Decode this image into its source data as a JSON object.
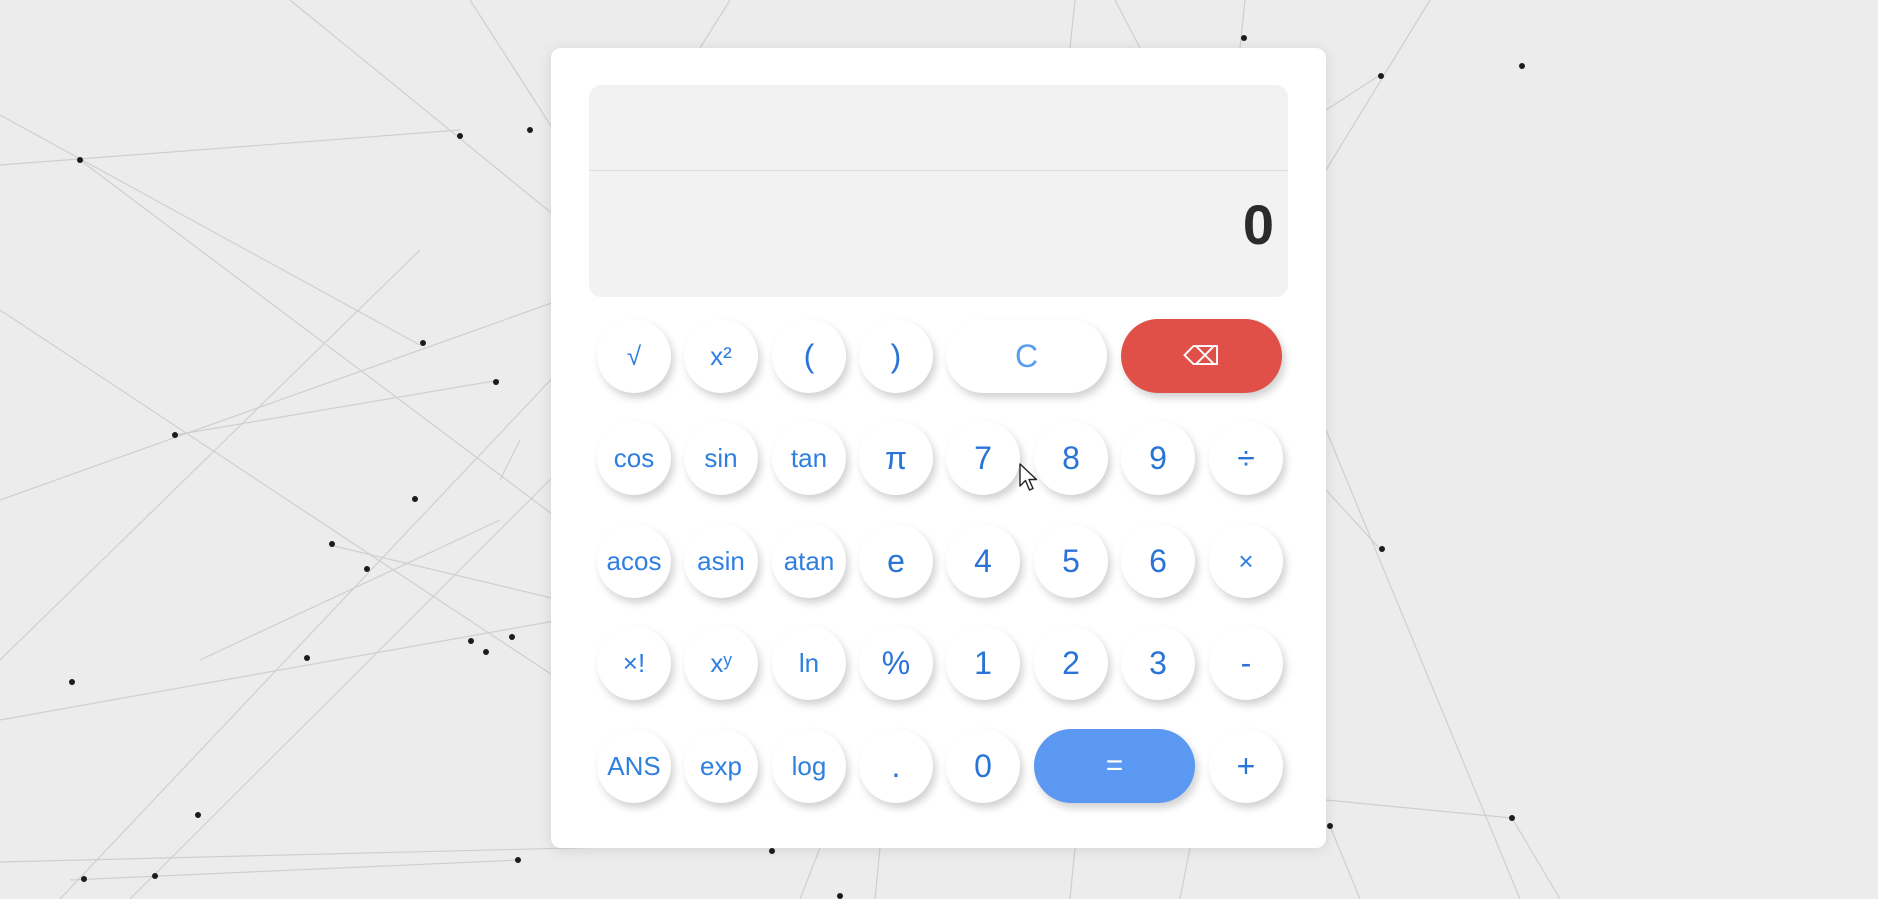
{
  "display": {
    "history": "",
    "result": "0"
  },
  "colors": {
    "accent": "#2f7fe0",
    "delete": "#e05048",
    "equals": "#5b98f2",
    "display_bg": "#f2f2f2"
  },
  "keys": {
    "sqrt": "√",
    "square": "x²",
    "paren_open": "(",
    "paren_close": ")",
    "clear": "C",
    "backspace": "⌫",
    "cos": "cos",
    "sin": "sin",
    "tan": "tan",
    "pi": "π",
    "seven": "7",
    "eight": "8",
    "nine": "9",
    "divide": "÷",
    "acos": "acos",
    "asin": "asin",
    "atan": "atan",
    "e": "e",
    "four": "4",
    "five": "5",
    "six": "6",
    "multiply": "×",
    "factorial": "×!",
    "power": "xʸ",
    "ln": "ln",
    "percent": "%",
    "one": "1",
    "two": "2",
    "three": "3",
    "minus": "-",
    "ans": "ANS",
    "exp": "exp",
    "log": "log",
    "decimal": ".",
    "zero": "0",
    "equals": "=",
    "plus": "+"
  }
}
